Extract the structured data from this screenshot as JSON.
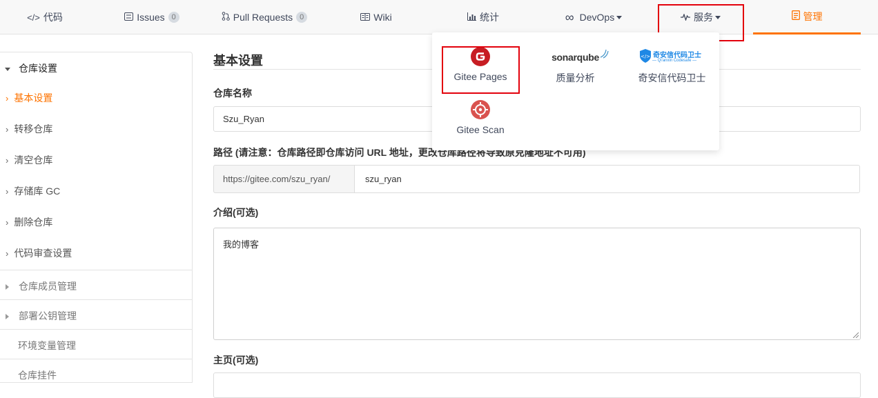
{
  "nav": {
    "code": "代码",
    "issues": "Issues",
    "issues_count": "0",
    "pull_requests": "Pull Requests",
    "pr_count": "0",
    "wiki": "Wiki",
    "stats": "统计",
    "devops": "DevOps",
    "services": "服务",
    "manage": "管理"
  },
  "services_menu": {
    "gitee_pages": "Gitee Pages",
    "sonarqube_logo": "sonarqube",
    "quality": "质量分析",
    "codesafe_logo_cn": "奇安信代码卫士",
    "codesafe_logo_en": "— Qi'anxin Codesafe —",
    "codesafe": "奇安信代码卫士",
    "gitee_scan": "Gitee Scan"
  },
  "sidebar": {
    "header": "仓库设置",
    "items": [
      "基本设置",
      "转移仓库",
      "清空仓库",
      "存储库 GC",
      "删除仓库",
      "代码审查设置"
    ],
    "groups": [
      "仓库成员管理",
      "部署公钥管理"
    ],
    "env": "环境变量管理",
    "hooks": "仓库挂件"
  },
  "main": {
    "title": "基本设置",
    "name_label": "仓库名称",
    "name_value": "Szu_Ryan",
    "path_label": "路径 (请注意：仓库路径即仓库访问 URL 地址，更改仓库路径将导致原克隆地址不可用)",
    "path_prefix": "https://gitee.com/szu_ryan/",
    "path_value": "szu_ryan",
    "intro_label": "介绍(可选)",
    "intro_value": "我的博客",
    "homepage_label": "主页(可选)"
  },
  "colors": {
    "accent": "#fe7300",
    "highlight": "#e3000b",
    "gitee_red": "#c71d23"
  }
}
